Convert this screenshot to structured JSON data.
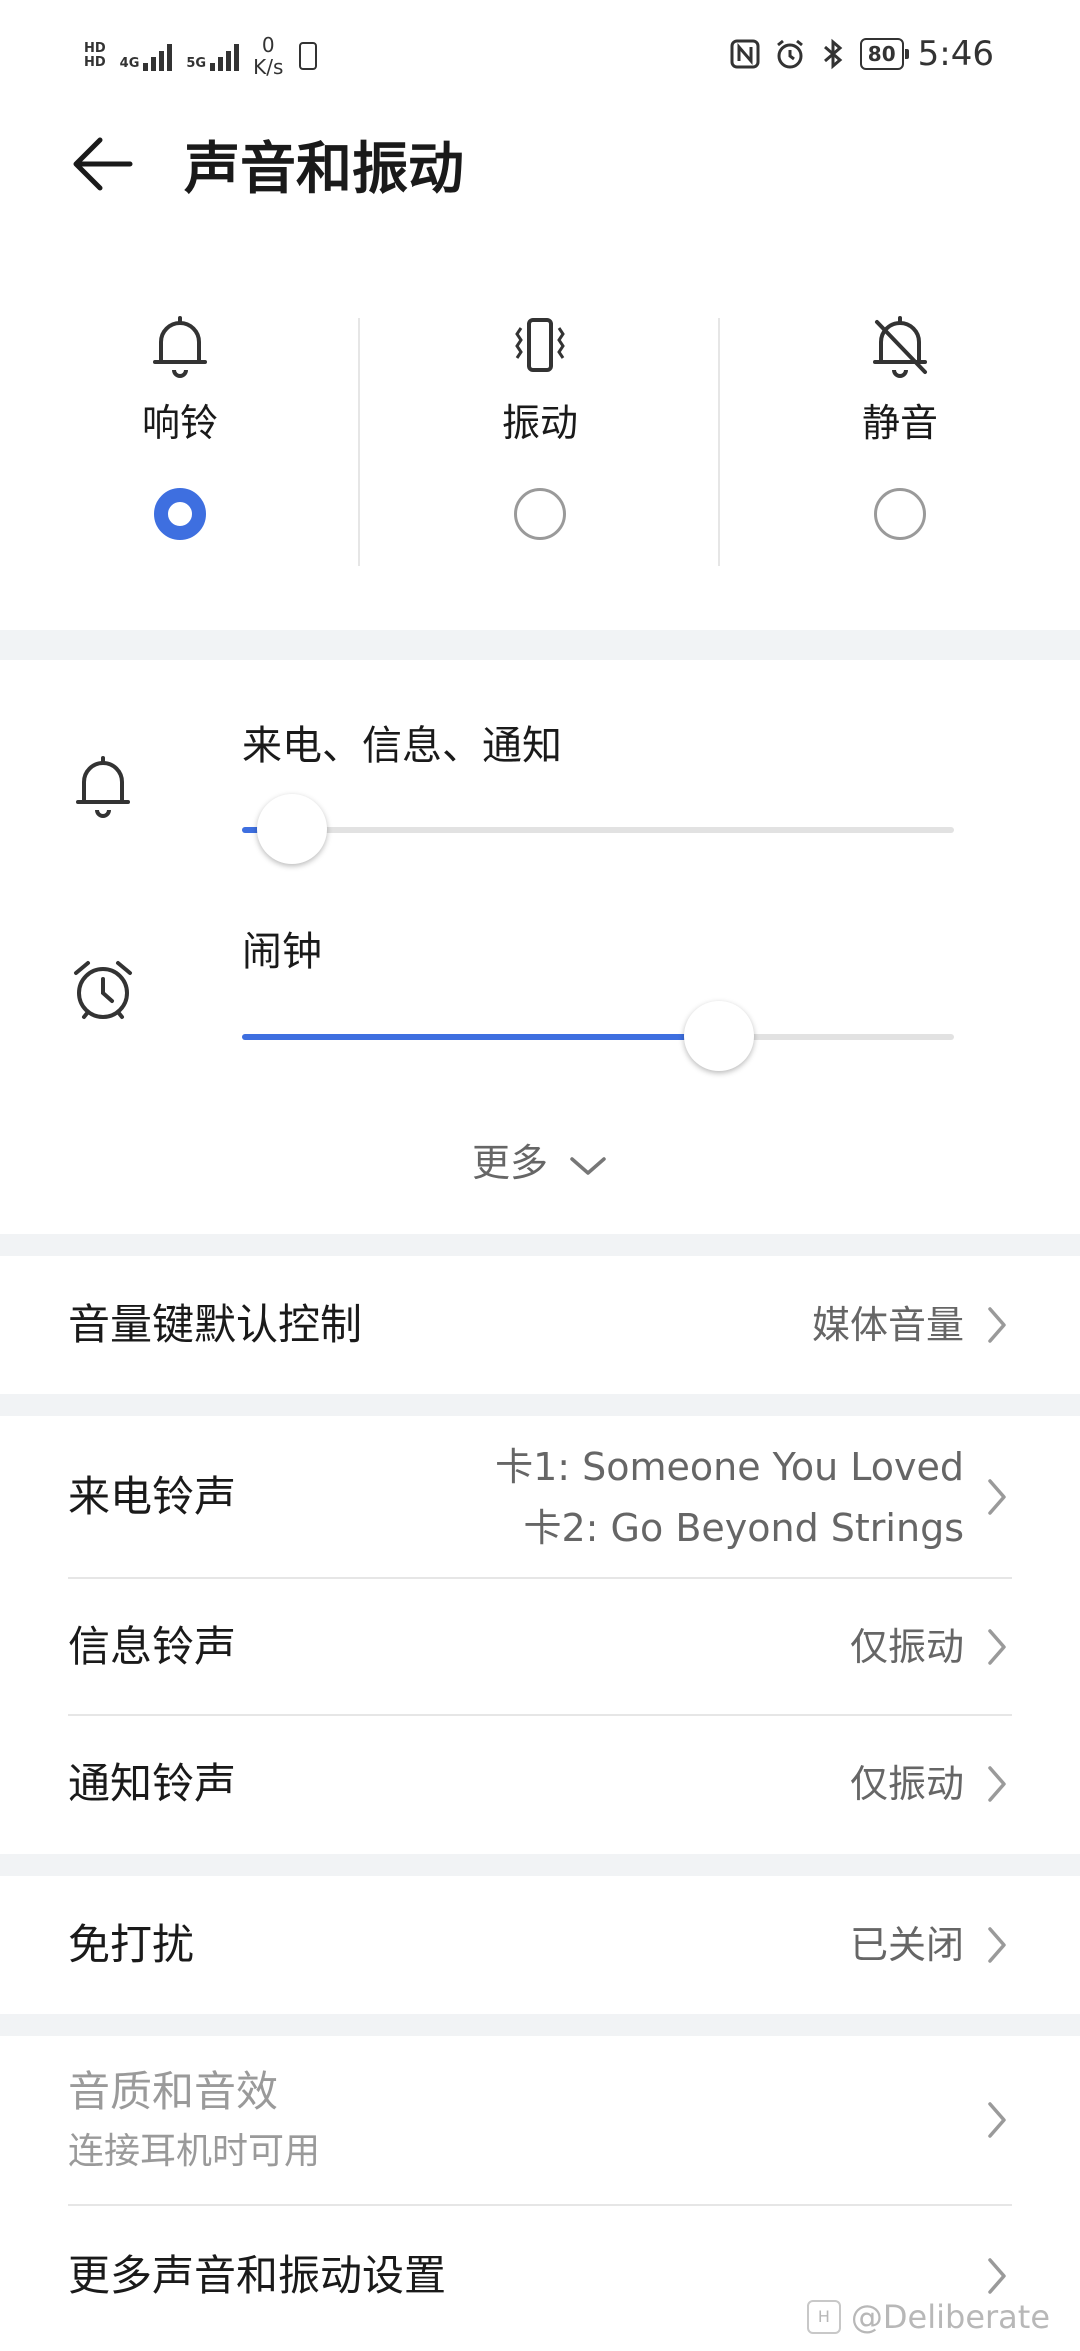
{
  "status_bar": {
    "hd_1": "HD",
    "hd_2": "HD",
    "net_4g": "4G",
    "net_5g": "5G",
    "speed_value": "0",
    "speed_unit": "K/s",
    "battery": "80",
    "time": "5:46",
    "icons": [
      "nfc-icon",
      "alarm-icon",
      "bluetooth-icon"
    ]
  },
  "header": {
    "title": "声音和振动"
  },
  "modes": [
    {
      "label": "响铃",
      "icon": "bell-icon",
      "selected": true
    },
    {
      "label": "振动",
      "icon": "vibrate-icon",
      "selected": false
    },
    {
      "label": "静音",
      "icon": "bell-off-icon",
      "selected": false
    }
  ],
  "volume": {
    "ringer": {
      "label": "来电、信息、通知",
      "level": 0.07,
      "icon": "bell-icon"
    },
    "alarm": {
      "label": "闹钟",
      "level": 0.67,
      "icon": "alarm-clock-icon"
    },
    "more_label": "更多"
  },
  "settings": {
    "volume_key": {
      "title": "音量键默认控制",
      "value": "媒体音量"
    },
    "call_ringtone": {
      "title": "来电铃声",
      "value_line1": "卡1: Someone You Loved",
      "value_line2": "卡2: Go Beyond Strings"
    },
    "message_ringtone": {
      "title": "信息铃声",
      "value": "仅振动"
    },
    "notification_ringtone": {
      "title": "通知铃声",
      "value": "仅振动"
    },
    "do_not_disturb": {
      "title": "免打扰",
      "value": "已关闭"
    },
    "sound_quality": {
      "title": "音质和音效",
      "subtitle": "连接耳机时可用"
    },
    "more_settings": {
      "title": "更多声音和振动设置"
    }
  },
  "watermark": {
    "text": "@Deliberate"
  },
  "colors": {
    "accent": "#3e6fe0",
    "background": "#f1f3f5"
  }
}
